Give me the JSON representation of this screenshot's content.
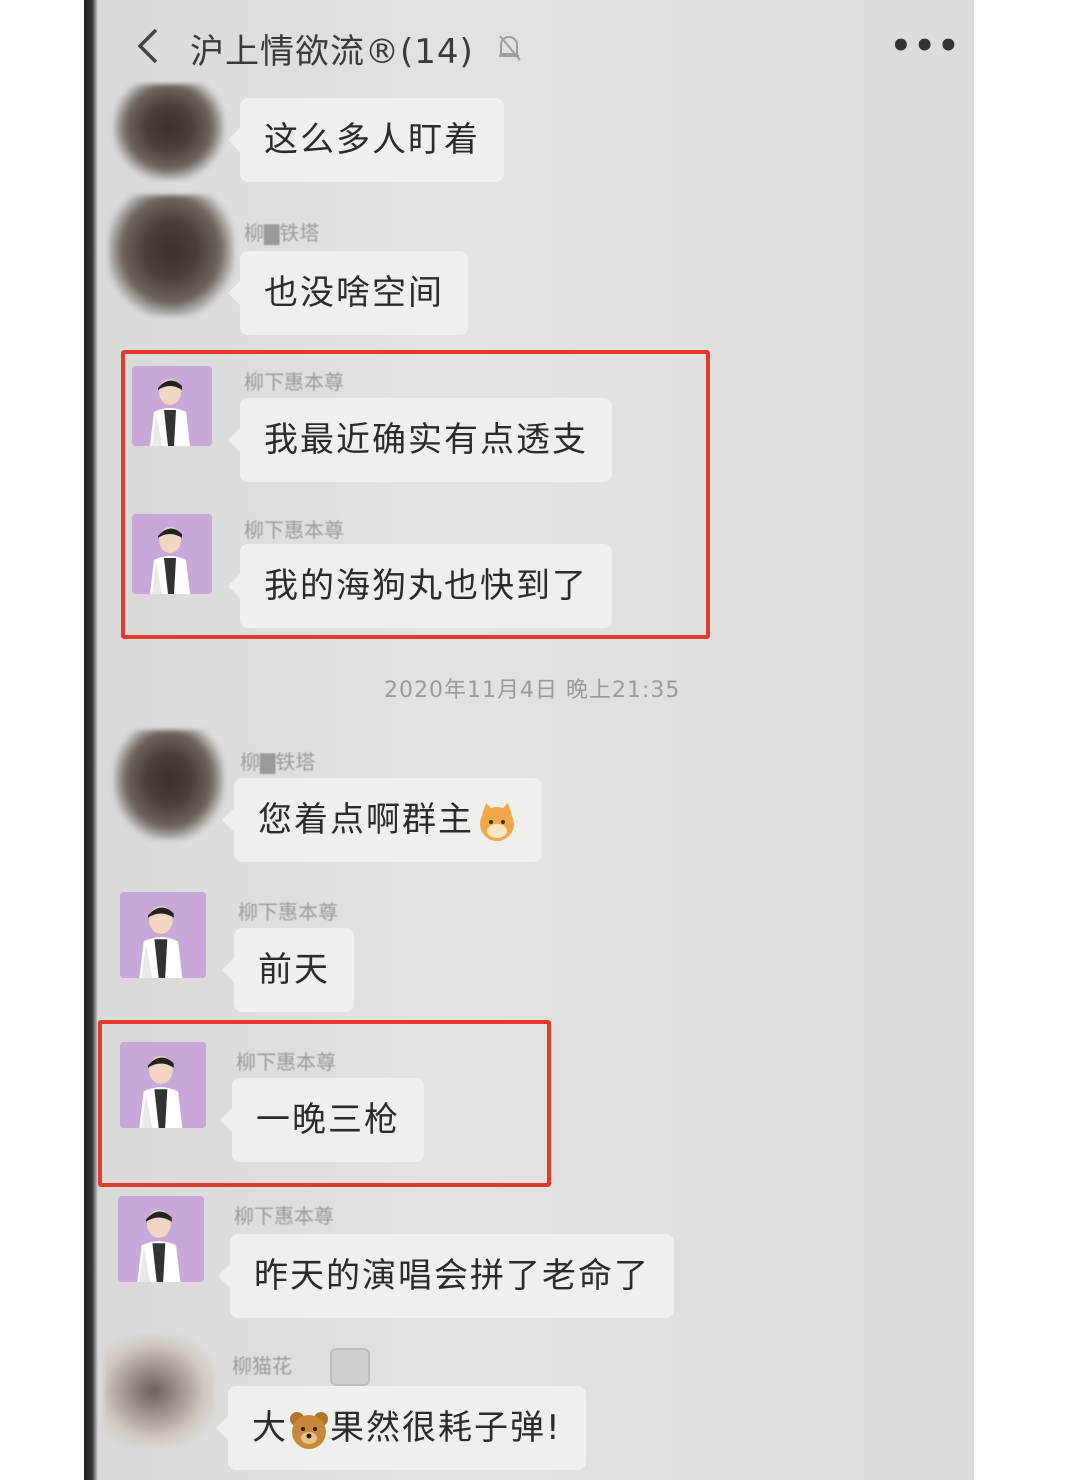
{
  "header": {
    "title": "沪上情欲流®(14)",
    "back_icon": "chevron-left-icon",
    "mute_icon": "bell-muted-icon",
    "more_icon": "more-dots-icon",
    "more_label": "•••"
  },
  "timestamp": "2020年11月4日 晚上21:35",
  "messages": [
    {
      "nickname": "",
      "text": "这么多人盯着"
    },
    {
      "nickname": "柳▇铁塔",
      "text": "也没啥空间"
    },
    {
      "nickname": "柳下惠本尊",
      "text": "我最近确实有点透支"
    },
    {
      "nickname": "柳下惠本尊",
      "text": "我的海狗丸也快到了"
    },
    {
      "nickname": "柳▇铁塔",
      "text": "您着点啊群主",
      "emoji": "cat-face-icon"
    },
    {
      "nickname": "柳下惠本尊",
      "text": "前天"
    },
    {
      "nickname": "柳下惠本尊",
      "text": "一晚三枪"
    },
    {
      "nickname": "柳下惠本尊",
      "text": "昨天的演唱会拼了老命了"
    },
    {
      "nickname": "柳猫花",
      "text_before": "大",
      "text_after": "果然很耗子弹!",
      "emoji": "bear-face-icon"
    }
  ],
  "colors": {
    "highlight": "#e23a2e",
    "bubble": "#efefed",
    "background": "#dedede"
  }
}
